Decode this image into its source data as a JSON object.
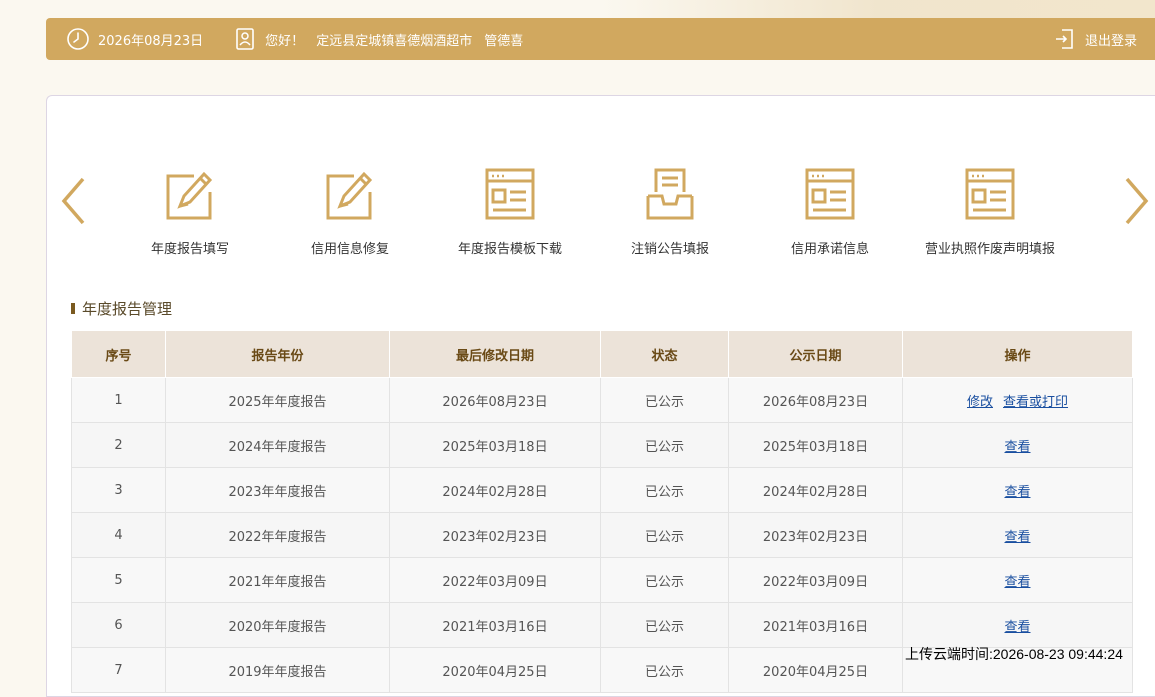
{
  "header": {
    "date": "2026年08月23日",
    "greeting": "您好！",
    "company": "定远县定城镇喜德烟酒超市",
    "user": "管德喜",
    "logout": "退出登录",
    "icons": {
      "date": "clock-icon",
      "user": "id-card-icon",
      "logout": "logout-icon"
    }
  },
  "colors": {
    "accent": "#d1a85f",
    "header_bg": "#ece3d9",
    "link": "#1a4fa0"
  },
  "shortcuts": [
    {
      "label": "年度报告填写",
      "icon": "edit-form-icon"
    },
    {
      "label": "信用信息修复",
      "icon": "edit-form-icon"
    },
    {
      "label": "年度报告模板下载",
      "icon": "document-window-icon"
    },
    {
      "label": "注销公告填报",
      "icon": "inbox-tray-icon"
    },
    {
      "label": "信用承诺信息",
      "icon": "document-window-icon"
    },
    {
      "label": "营业执照作废声明填报",
      "icon": "document-window-icon"
    }
  ],
  "section": {
    "title": "年度报告管理"
  },
  "table": {
    "columns": [
      "序号",
      "报告年份",
      "最后修改日期",
      "状态",
      "公示日期",
      "操作"
    ],
    "rows": [
      {
        "no": "1",
        "year": "2025年年度报告",
        "modified": "2026年08月23日",
        "status": "已公示",
        "published": "2026年08月23日",
        "actions": [
          "修改",
          "查看或打印"
        ]
      },
      {
        "no": "2",
        "year": "2024年年度报告",
        "modified": "2025年03月18日",
        "status": "已公示",
        "published": "2025年03月18日",
        "actions": [
          "查看"
        ]
      },
      {
        "no": "3",
        "year": "2023年年度报告",
        "modified": "2024年02月28日",
        "status": "已公示",
        "published": "2024年02月28日",
        "actions": [
          "查看"
        ]
      },
      {
        "no": "4",
        "year": "2022年年度报告",
        "modified": "2023年02月23日",
        "status": "已公示",
        "published": "2023年02月23日",
        "actions": [
          "查看"
        ]
      },
      {
        "no": "5",
        "year": "2021年年度报告",
        "modified": "2022年03月09日",
        "status": "已公示",
        "published": "2022年03月09日",
        "actions": [
          "查看"
        ]
      },
      {
        "no": "6",
        "year": "2020年年度报告",
        "modified": "2021年03月16日",
        "status": "已公示",
        "published": "2021年03月16日",
        "actions": [
          "查看"
        ]
      },
      {
        "no": "7",
        "year": "2019年年度报告",
        "modified": "2020年04月25日",
        "status": "已公示",
        "published": "2020年04月25日",
        "actions": []
      }
    ]
  },
  "upload_stamp": "上传云端时间:2026-08-23 09:44:24"
}
